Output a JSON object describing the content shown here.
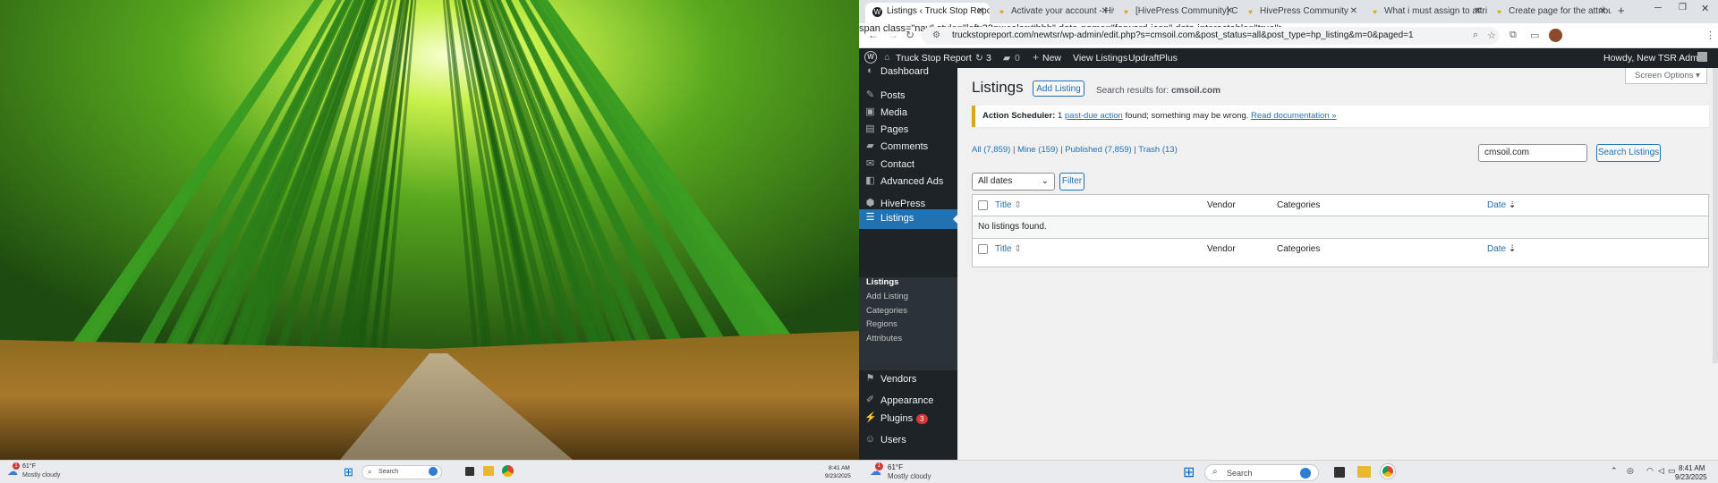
{
  "left_monitor": {
    "weather": {
      "temp": "61°F",
      "cond": "Mostly cloudy",
      "badge": "1"
    },
    "search_label": "Search",
    "clock": {
      "time": "8:41 AM",
      "date": "9/23/2025"
    }
  },
  "browser": {
    "tabs": [
      {
        "label": "Listings ‹ Truck Stop Report",
        "active": true
      },
      {
        "label": "Activate your account - Hive",
        "active": false
      },
      {
        "label": "[HivePress Community] Co",
        "active": false
      },
      {
        "label": "HivePress Community",
        "active": false
      },
      {
        "label": "What i must assign to attrib",
        "active": false
      },
      {
        "label": "Create page for the attribut",
        "active": false
      }
    ],
    "new_tab": "+",
    "url": "truckstopreport.com/newtsr/wp-admin/edit.php?s=cmsoil.com&post_status=all&post_type=hp_listing&m=0&paged=1"
  },
  "admin_bar": {
    "site": "Truck Stop Report",
    "updates": "3",
    "comments": "0",
    "new": "New",
    "view": "View Listings",
    "plugin": "UpdraftPlus",
    "howdy": "Howdy, New TSR Admin"
  },
  "sidebar": {
    "items": [
      {
        "label": "Dashboard",
        "icon": "dashboard-icon"
      },
      {
        "label": "Posts",
        "icon": "pin-icon"
      },
      {
        "label": "Media",
        "icon": "media-icon"
      },
      {
        "label": "Pages",
        "icon": "page-icon"
      },
      {
        "label": "Comments",
        "icon": "comment-icon"
      },
      {
        "label": "Contact",
        "icon": "mail-icon"
      },
      {
        "label": "Advanced Ads",
        "icon": "ads-icon"
      },
      {
        "label": "HivePress",
        "icon": "hivepress-icon"
      },
      {
        "label": "Listings",
        "icon": "listings-icon"
      },
      {
        "label": "Vendors",
        "icon": "vendors-icon"
      },
      {
        "label": "Appearance",
        "icon": "brush-icon"
      },
      {
        "label": "Plugins",
        "icon": "plugin-icon",
        "badge": "3"
      },
      {
        "label": "Users",
        "icon": "users-icon"
      }
    ],
    "submenu": [
      "Listings",
      "Add Listing",
      "Categories",
      "Regions",
      "Attributes"
    ]
  },
  "main": {
    "title": "Listings",
    "add_button": "Add Listing",
    "search_results_prefix": "Search results for:",
    "search_term": "cmsoil.com",
    "screen_options": "Screen Options ▾",
    "notice": {
      "prefix": "Action Scheduler:",
      "count": "1",
      "link1": "past-due action",
      "mid": "found; something may be wrong.",
      "link2": "Read documentation »"
    },
    "views": [
      "All (7,859)",
      "Mine (159)",
      "Published (7,859)",
      "Trash (13)"
    ],
    "search_value": "cmsoil.com",
    "search_button": "Search Listings",
    "date_filter": "All dates",
    "filter_button": "Filter",
    "columns": {
      "title": "Title",
      "vendor": "Vendor",
      "categories": "Categories",
      "date": "Date"
    },
    "empty": "No listings found."
  },
  "right_taskbar": {
    "weather": {
      "temp": "61°F",
      "cond": "Mostly cloudy",
      "badge": "1"
    },
    "search_label": "Search",
    "clock": {
      "time": "8:41 AM",
      "date": "9/23/2025"
    }
  },
  "colors": {
    "wp_dark": "#1d2327",
    "wp_blue": "#2271b1",
    "notice_yellow": "#dba617"
  }
}
